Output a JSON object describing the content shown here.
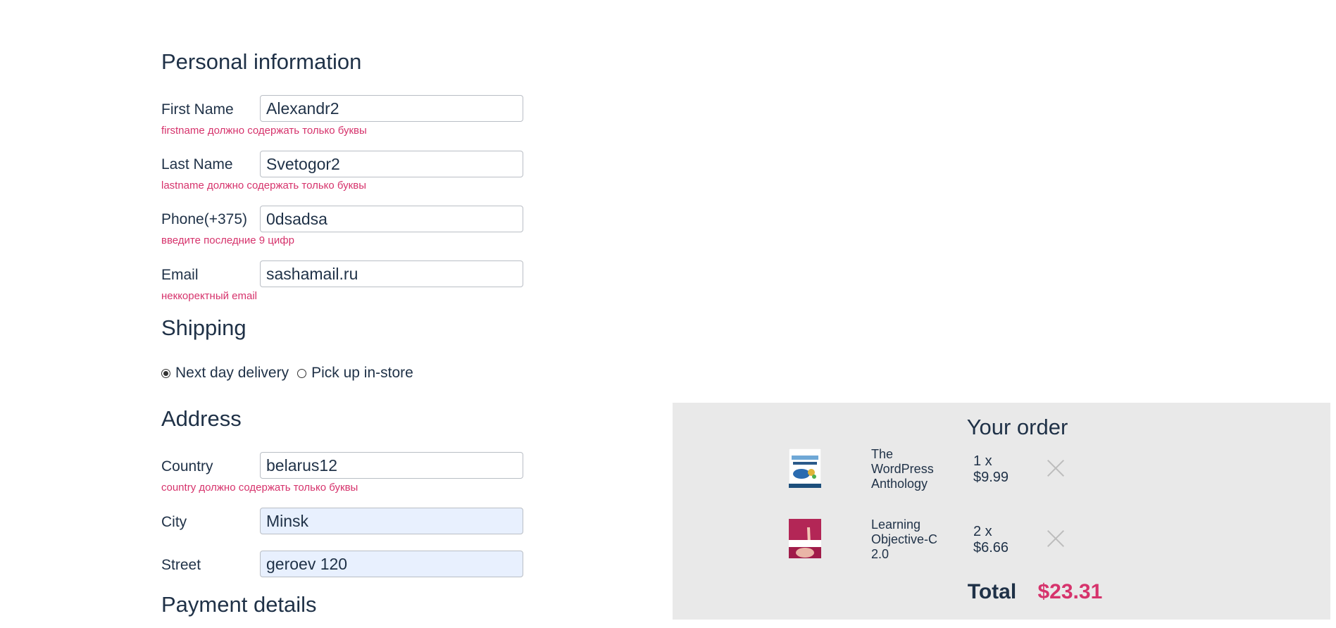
{
  "personal": {
    "heading": "Personal information",
    "first_name": {
      "label": "First Name",
      "value": "Alexandr2",
      "error": "firstname должно содержать только буквы"
    },
    "last_name": {
      "label": "Last Name",
      "value": "Svetogor2",
      "error": "lastname должно содержать только буквы"
    },
    "phone": {
      "label": "Phone(+375)",
      "value": "0dsadsa",
      "error": "введите последние 9 цифр"
    },
    "email": {
      "label": "Email",
      "value": "sashamail.ru",
      "error": "неккоректный email"
    }
  },
  "shipping": {
    "heading": "Shipping",
    "options": [
      {
        "label": "Next day delivery",
        "selected": true
      },
      {
        "label": "Pick up in-store",
        "selected": false
      }
    ]
  },
  "address": {
    "heading": "Address",
    "country": {
      "label": "Country",
      "value": "belarus12",
      "error": "country должно содержать только буквы"
    },
    "city": {
      "label": "City",
      "value": "Minsk"
    },
    "street": {
      "label": "Street",
      "value": "geroev 120"
    }
  },
  "payment": {
    "heading": "Payment details"
  },
  "order": {
    "heading": "Your order",
    "items": [
      {
        "title": "The WordPress Anthology",
        "qty_line": "1 x",
        "price": "$9.99",
        "cover_icon": "book-cover-wordpress"
      },
      {
        "title": "Learning Objective-C 2.0",
        "qty_line": "2 x",
        "price": "$6.66",
        "cover_icon": "book-cover-objective-c"
      }
    ],
    "total_label": "Total",
    "total_value": "$23.31"
  },
  "colors": {
    "error": "#d6336c",
    "text": "#1f3147",
    "panel": "#e9e9e9",
    "autofill": "#e8f0fe"
  }
}
